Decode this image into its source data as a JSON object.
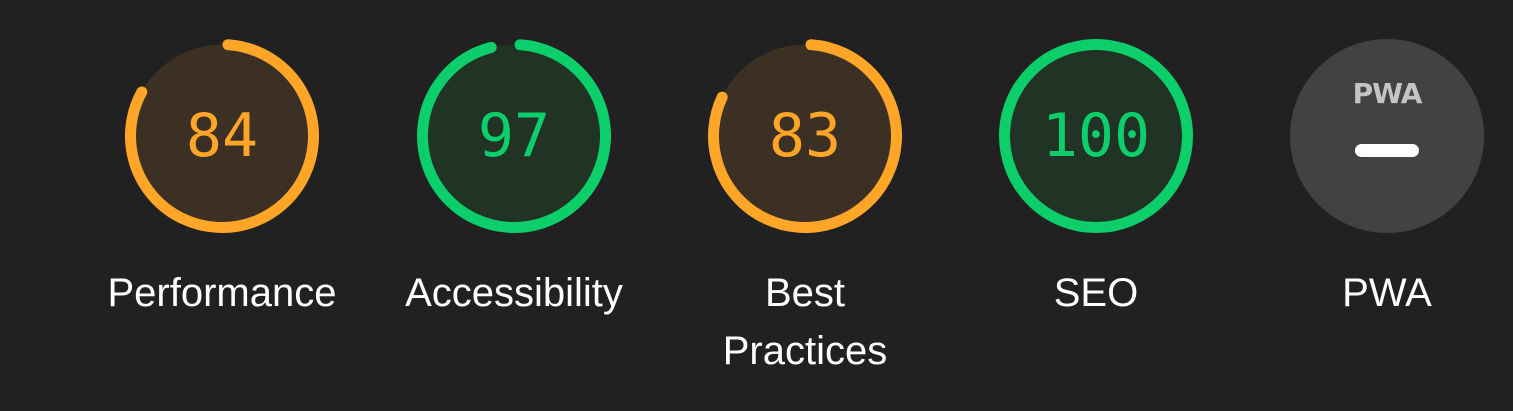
{
  "categories": [
    {
      "id": "performance",
      "label": "Performance",
      "score": "84",
      "fraction": 0.84,
      "color": "#ffa629",
      "fill": "#3c3024"
    },
    {
      "id": "accessibility",
      "label": "Accessibility",
      "score": "97",
      "fraction": 0.97,
      "color": "#0cce6b",
      "fill": "#203324"
    },
    {
      "id": "best-practices",
      "label": "Best Practices",
      "score": "83",
      "fraction": 0.83,
      "color": "#ffa629",
      "fill": "#3c3024"
    },
    {
      "id": "seo",
      "label": "SEO",
      "score": "100",
      "fraction": 1.0,
      "color": "#0cce6b",
      "fill": "#203324"
    }
  ],
  "pwa": {
    "label": "PWA",
    "logo_text": "PWA",
    "badge_color": "#424242"
  }
}
